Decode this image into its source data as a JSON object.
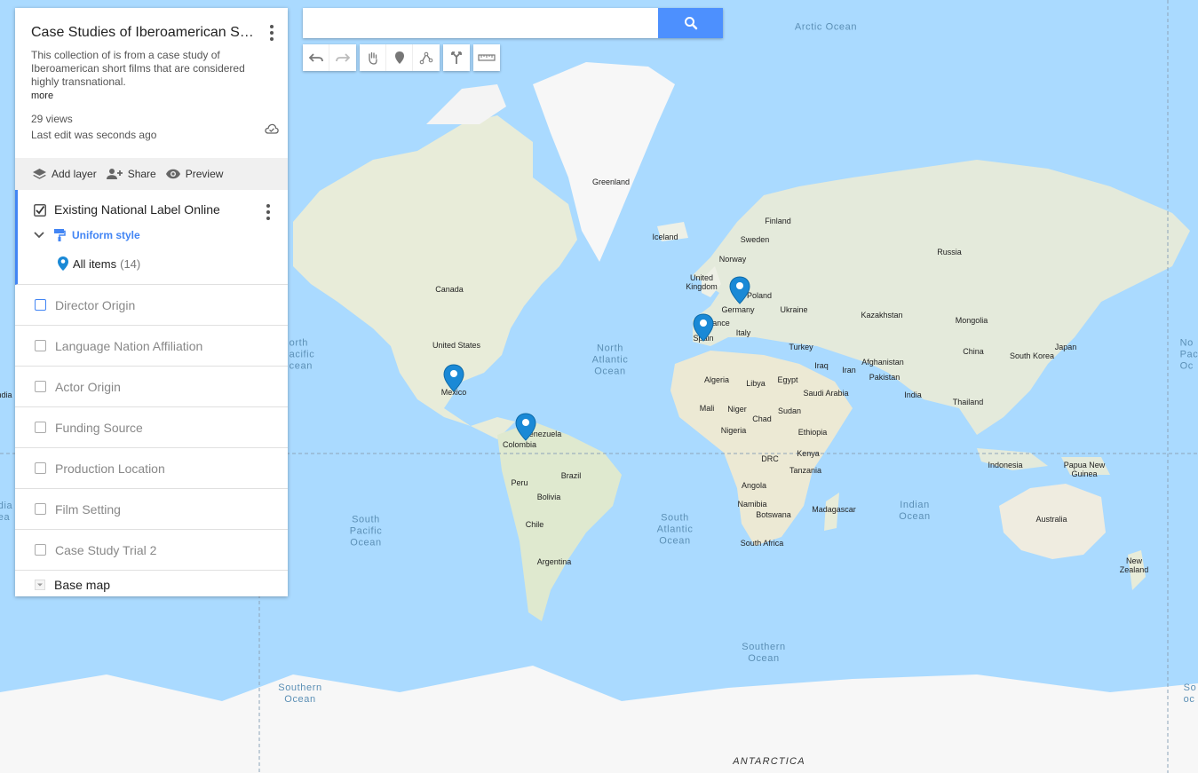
{
  "map": {
    "title": "Case Studies of Iberoamerican Short Films",
    "description": "This collection of is from a case study of Iberoamerican short films that are considered highly transnational.",
    "more_label": "more",
    "views": "29 views",
    "last_edit": "Last edit was seconds ago"
  },
  "actions": {
    "add_layer": "Add layer",
    "share": "Share",
    "preview": "Preview"
  },
  "active_layer": {
    "name": "Existing National Label Online",
    "checked": true,
    "style": "Uniform style",
    "items_label": "All items",
    "items_count": "(14)"
  },
  "layers": [
    {
      "name": "Director Origin",
      "checked": false
    },
    {
      "name": "Language Nation Affiliation",
      "checked": false
    },
    {
      "name": "Actor Origin",
      "checked": false
    },
    {
      "name": "Funding Source",
      "checked": false
    },
    {
      "name": "Production Location",
      "checked": false
    },
    {
      "name": "Film Setting",
      "checked": false
    },
    {
      "name": "Case Study Trial 2",
      "checked": false
    }
  ],
  "base_map": "Base map",
  "search": {
    "value": "",
    "placeholder": ""
  },
  "colors": {
    "accent": "#4285f4",
    "search_button": "#4d90fe",
    "pin": "#1a89d6",
    "ocean": "#aadaff",
    "land": "#eef0e6"
  },
  "map_labels": {
    "greenland": "Greenland",
    "iceland": "Iceland",
    "finland": "Finland",
    "sweden": "Sweden",
    "norway": "Norway",
    "russia": "Russia",
    "uk": "United\nKingdom",
    "poland": "Poland",
    "germany": "Germany",
    "ukraine": "Ukraine",
    "kazakhstan": "Kazakhstan",
    "mongolia": "Mongolia",
    "france": "ance",
    "italy": "Italy",
    "spain": "Spain",
    "turkey": "Turkey",
    "china": "China",
    "south_korea": "South Korea",
    "japan": "Japan",
    "afghanistan": "Afghanistan",
    "iraq": "Iraq",
    "iran": "Iran",
    "pakistan": "Pakistan",
    "algeria": "Algeria",
    "libya": "Libya",
    "egypt": "Egypt",
    "saudi": "Saudi Arabia",
    "india": "India",
    "thailand": "Thailand",
    "mali": "Mali",
    "niger": "Niger",
    "chad": "Chad",
    "sudan": "Sudan",
    "nigeria": "Nigeria",
    "ethiopia": "Ethiopia",
    "drc": "DRC",
    "kenya": "Kenya",
    "tanzania": "Tanzania",
    "indonesia": "Indonesia",
    "png": "Papua New\nGuinea",
    "angola": "Angola",
    "namibia": "Namibia",
    "botswana": "Botswana",
    "madagascar": "Madagascar",
    "south_africa": "South Africa",
    "australia": "Australia",
    "new_zealand": "New\nZealand",
    "canada": "Canada",
    "us": "United States",
    "mexico": "Mexico",
    "venezuela": "enezuela",
    "colombia": "Colombia",
    "peru": "Peru",
    "brazil": "Brazil",
    "bolivia": "Bolivia",
    "chile": "Chile",
    "argentina": "Argentina",
    "antarctica": "ANTARCTICA",
    "arctic": "Arctic Ocean",
    "north_atlantic": "North\nAtlantic\nOcean",
    "north_pacific": "orth\nacific\ncean",
    "north_pacific_r": "No\nPac\nOc",
    "indian": "Indian\nOcean",
    "south_pacific": "South\nPacific\nOcean",
    "south_atlantic": "South\nAtlantic\nOcean",
    "southern1": "Southern\nOcean",
    "southern2": "Southern\nOcean",
    "southern3": "So\noc",
    "india_l": "ndia",
    "indian_l": "dia\nea"
  }
}
